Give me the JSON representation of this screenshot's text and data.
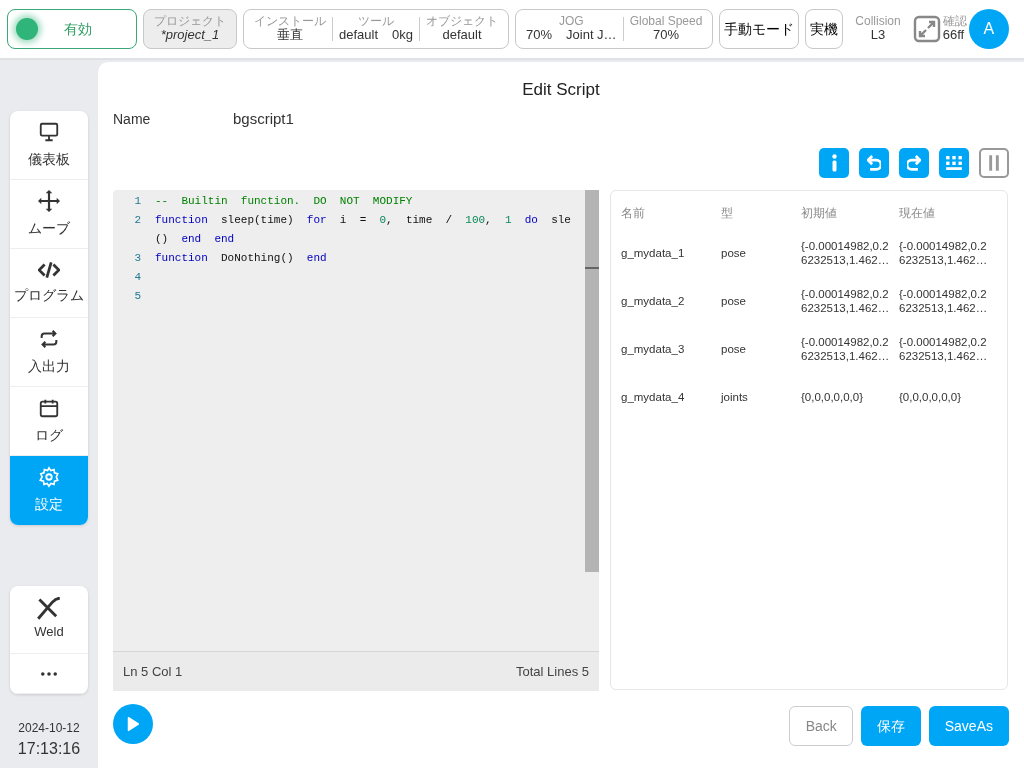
{
  "top_bar": {
    "status": {
      "label": "有効",
      "on": true
    },
    "project": {
      "label": "プロジェクト",
      "value": "*project_1"
    },
    "install_group": [
      {
        "label": "インストール",
        "values": [
          "垂直"
        ]
      },
      {
        "label": "ツール",
        "values": [
          "default",
          "0kg"
        ]
      },
      {
        "label": "オブジェクト",
        "values": [
          "default"
        ]
      }
    ],
    "speed_group": [
      {
        "label": "JOG",
        "values": [
          "70%",
          "Joint J…"
        ]
      },
      {
        "label": "Global Speed",
        "values": [
          "70%"
        ]
      }
    ],
    "mode_buttons": [
      "手動モード",
      "実機"
    ],
    "collision": {
      "label": "Collision",
      "value": "L3"
    },
    "confirm": {
      "label": "確認",
      "value": "66ff"
    },
    "avatar": "A"
  },
  "sidebar": {
    "items": [
      {
        "label": "儀表板",
        "selected": false
      },
      {
        "label": "ムーブ",
        "selected": false
      },
      {
        "label": "プログラム",
        "selected": false
      },
      {
        "label": "入出力",
        "selected": false
      },
      {
        "label": "ログ",
        "selected": false
      },
      {
        "label": "設定",
        "selected": true
      }
    ],
    "extra_item": "Weld",
    "date": "2024-10-12",
    "time": "17:13:16"
  },
  "editor_page": {
    "title": "Edit Script",
    "name_label": "Name",
    "name_value": "bgscript1",
    "code_lines": [
      {
        "number": "1",
        "tokens": [
          {
            "text": "--  Builtin  function.  DO  NOT  MODIFY",
            "kind": "comment"
          }
        ]
      },
      {
        "number": "2",
        "tokens": [
          {
            "text": "function",
            "kind": "keyword"
          },
          {
            "text": "  sleep(time)  ",
            "kind": "plain"
          },
          {
            "text": "for",
            "kind": "keyword"
          },
          {
            "text": "  i  =  ",
            "kind": "plain"
          },
          {
            "text": "0",
            "kind": "number"
          },
          {
            "text": ",  time  /  ",
            "kind": "plain"
          },
          {
            "text": "100",
            "kind": "number"
          },
          {
            "text": ",  ",
            "kind": "plain"
          },
          {
            "text": "1  ",
            "kind": "number"
          },
          {
            "text": "do",
            "kind": "keyword"
          },
          {
            "text": "  sle",
            "kind": "plain"
          }
        ]
      },
      {
        "tokens": [
          {
            "text": "()  ",
            "kind": "plain"
          },
          {
            "text": "end  ",
            "kind": "keyword"
          },
          {
            "text": "end",
            "kind": "keyword"
          }
        ]
      },
      {
        "number": "3",
        "tokens": [
          {
            "text": "function",
            "kind": "keyword"
          },
          {
            "text": "  DoNothing()  ",
            "kind": "plain"
          },
          {
            "text": "end",
            "kind": "keyword"
          }
        ]
      },
      {
        "number": "4"
      },
      {
        "number": "5"
      }
    ],
    "status_left": "Ln 5 Col 1",
    "status_right": "Total Lines 5",
    "variables": {
      "columns": [
        "名前",
        "型",
        "初期値",
        "現在値"
      ],
      "rows": [
        [
          [
            "g_mydata_1"
          ],
          [
            "pose"
          ],
          [
            "{-0.00014982,0.2",
            "6232513,1.462…"
          ],
          [
            "{-0.00014982,0.2",
            "6232513,1.462…"
          ]
        ],
        [
          [
            "g_mydata_2"
          ],
          [
            "pose"
          ],
          [
            "{-0.00014982,0.2",
            "6232513,1.462…"
          ],
          [
            "{-0.00014982,0.2",
            "6232513,1.462…"
          ]
        ],
        [
          [
            "g_mydata_3"
          ],
          [
            "pose"
          ],
          [
            "{-0.00014982,0.2",
            "6232513,1.462…"
          ],
          [
            "{-0.00014982,0.2",
            "6232513,1.462…"
          ]
        ],
        [
          [
            "g_mydata_4"
          ],
          [
            "joints"
          ],
          [
            "{0,0,0,0,0,0}"
          ],
          [
            "{0,0,0,0,0,0}"
          ]
        ]
      ]
    },
    "buttons": [
      {
        "label": "Back",
        "kind": "outline"
      },
      {
        "label": "保存",
        "kind": "primary"
      },
      {
        "label": "SaveAs",
        "kind": "primary"
      }
    ]
  }
}
